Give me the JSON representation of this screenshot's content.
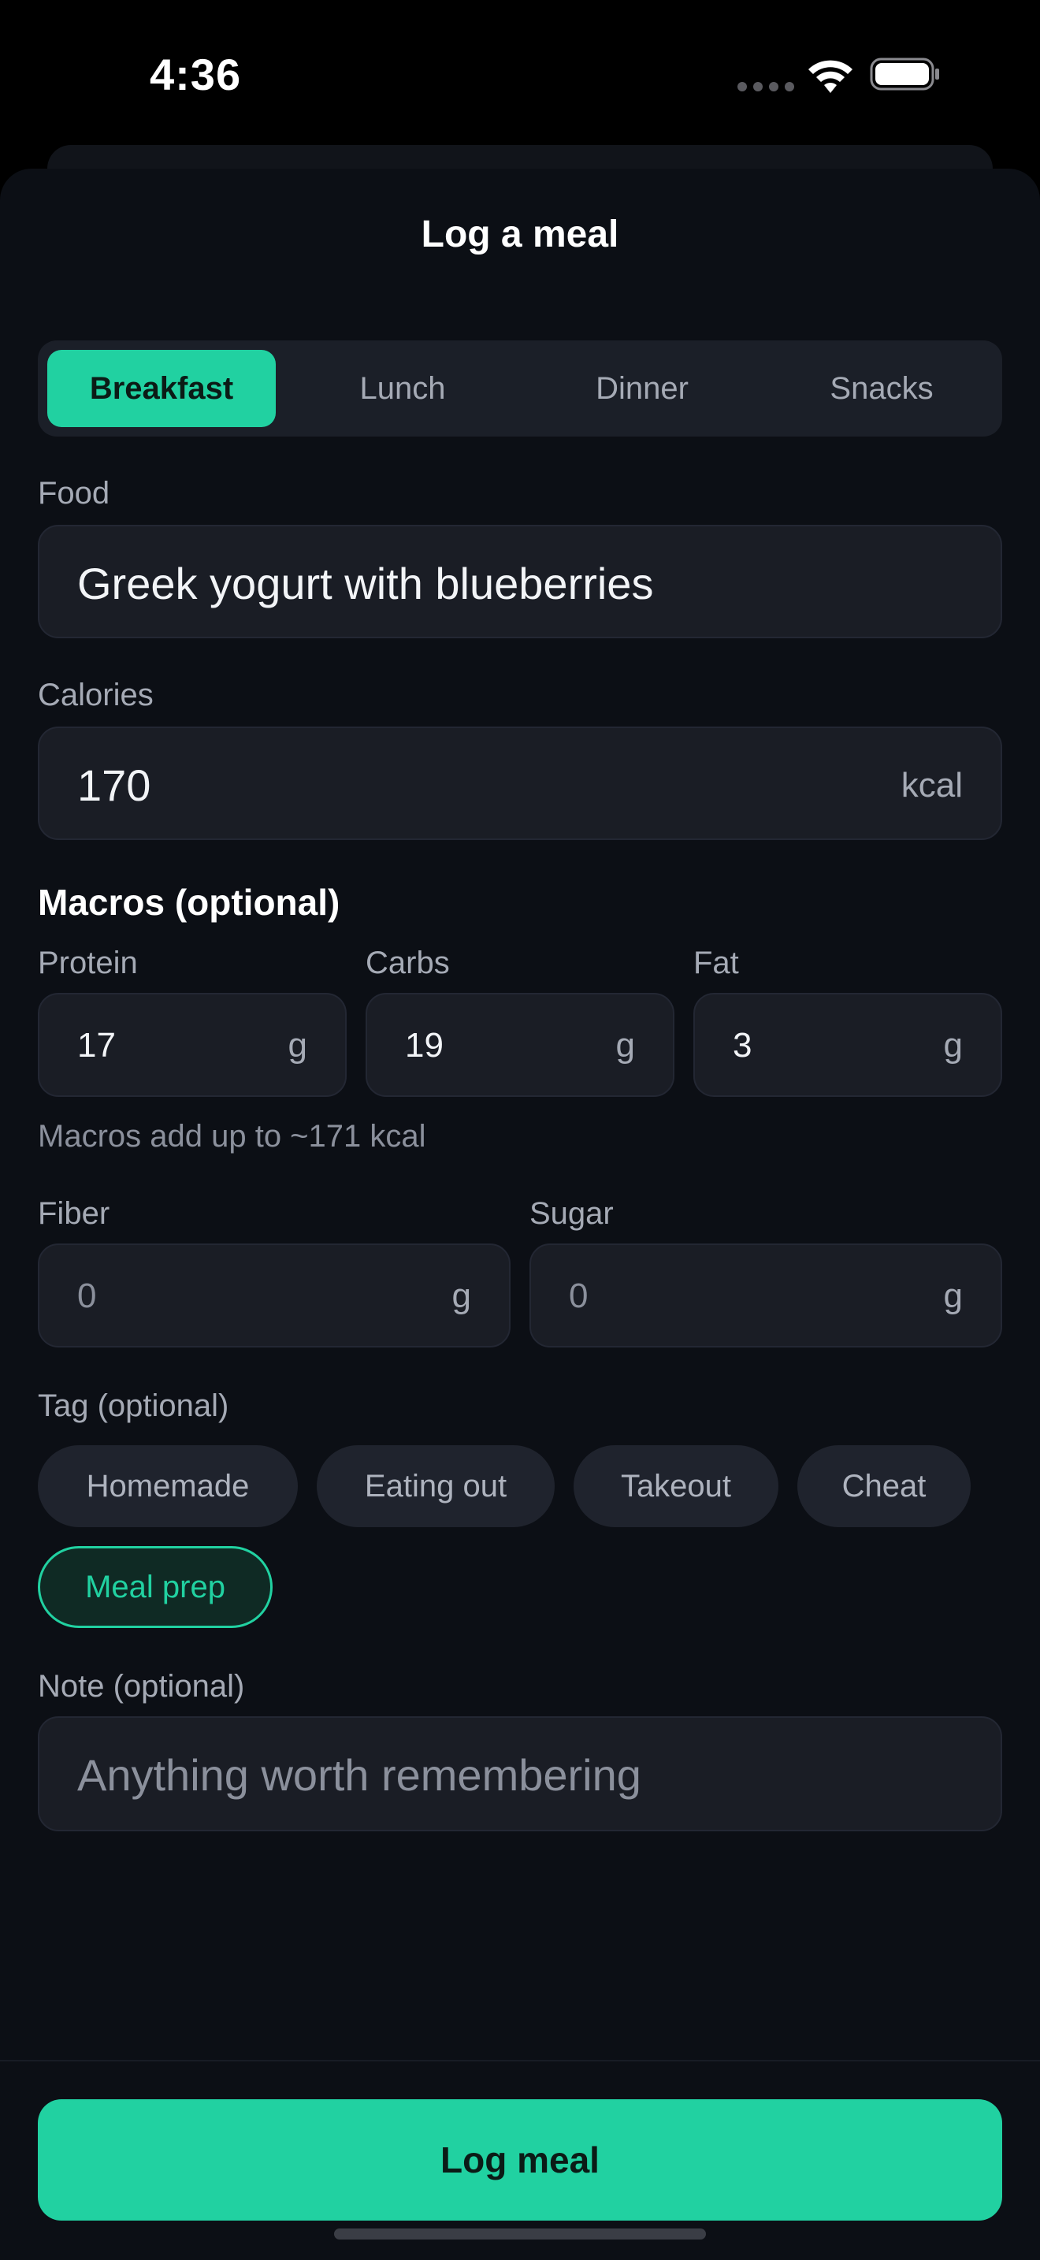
{
  "status_bar": {
    "time": "4:36"
  },
  "sheet": {
    "title": "Log a meal"
  },
  "meal_tabs": [
    {
      "label": "Breakfast",
      "selected": true
    },
    {
      "label": "Lunch",
      "selected": false
    },
    {
      "label": "Dinner",
      "selected": false
    },
    {
      "label": "Snacks",
      "selected": false
    }
  ],
  "food": {
    "label": "Food",
    "value": "Greek yogurt with blueberries"
  },
  "calories": {
    "label": "Calories",
    "value": "170",
    "unit": "kcal"
  },
  "macros": {
    "heading": "Macros (optional)",
    "protein": {
      "label": "Protein",
      "value": "17",
      "unit": "g"
    },
    "carbs": {
      "label": "Carbs",
      "value": "19",
      "unit": "g"
    },
    "fat": {
      "label": "Fat",
      "value": "3",
      "unit": "g"
    },
    "helper": "Macros add up to ~171 kcal"
  },
  "fiber": {
    "label": "Fiber",
    "placeholder": "0",
    "unit": "g"
  },
  "sugar": {
    "label": "Sugar",
    "placeholder": "0",
    "unit": "g"
  },
  "tags": {
    "label": "Tag (optional)",
    "items": [
      {
        "label": "Homemade",
        "selected": false
      },
      {
        "label": "Eating out",
        "selected": false
      },
      {
        "label": "Takeout",
        "selected": false
      },
      {
        "label": "Cheat",
        "selected": false
      },
      {
        "label": "Meal prep",
        "selected": true
      }
    ]
  },
  "note": {
    "label": "Note (optional)",
    "placeholder": "Anything worth remembering"
  },
  "submit": {
    "label": "Log meal"
  },
  "colors": {
    "accent": "#21d1a1",
    "background": "#0c0f15",
    "field": "#1a1d25"
  }
}
